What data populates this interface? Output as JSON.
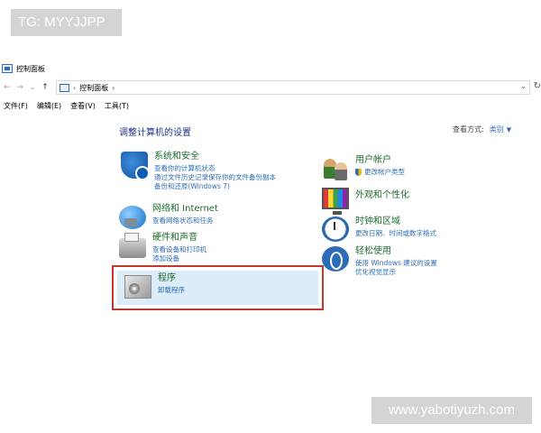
{
  "watermarks": {
    "top": "TG: MYYJJPP",
    "bottom": "www.yabotiyuzh.com"
  },
  "window": {
    "title": "控制面板"
  },
  "nav": {
    "back": "←",
    "forward": "→",
    "dropdown": "⌄",
    "up": "↑",
    "separator": "›",
    "path": "控制面板",
    "path_end": "›",
    "address_drop": "⌄",
    "refresh": "↻"
  },
  "menu": [
    "文件(F)",
    "编辑(E)",
    "查看(V)",
    "工具(T)"
  ],
  "main": {
    "heading": "调整计算机的设置",
    "view_by_label": "查看方式:",
    "view_by_value": "类别",
    "view_by_arrow": "▼"
  },
  "categories_left": [
    {
      "title": "系统和安全",
      "links": [
        "查看你的计算机状态",
        "通过文件历史记录保存你的文件备份副本",
        "备份和还原(Windows 7)"
      ]
    },
    {
      "title": "网络和 Internet",
      "links": [
        "查看网络状态和任务"
      ]
    },
    {
      "title": "硬件和声音",
      "links": [
        "查看设备和打印机",
        "添加设备"
      ]
    },
    {
      "title": "程序",
      "links": [
        "卸载程序"
      ]
    }
  ],
  "categories_right": [
    {
      "title": "用户帐户",
      "links": [
        "更改帐户类型"
      ]
    },
    {
      "title": "外观和个性化",
      "links": []
    },
    {
      "title": "时钟和区域",
      "links": [
        "更改日期、时间或数字格式"
      ]
    },
    {
      "title": "轻松使用",
      "links": [
        "使用 Windows 建议的设置",
        "优化视觉显示"
      ]
    }
  ],
  "colors": {
    "heading": "#1e3287",
    "category_title": "#1e6b2e",
    "link": "#2c6cb8",
    "highlight_border": "#c0392b",
    "highlight_fill": "#dcecf8"
  }
}
